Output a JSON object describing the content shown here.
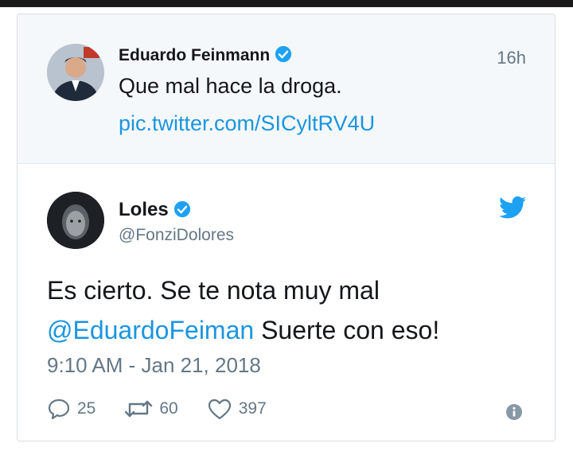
{
  "quoted_tweet": {
    "name": "Eduardo Feinmann",
    "time": "16h",
    "text": "Que mal hace la droga.",
    "link": "pic.twitter.com/SICyltRV4U"
  },
  "main_tweet": {
    "name": "Loles",
    "handle": "@FonziDolores",
    "text_line1": "Es cierto. Se te nota muy mal",
    "mention": "@EduardoFeiman",
    "text_line2_rest": " Suerte con eso!",
    "date": "9:10 AM - Jan 21, 2018",
    "replies": "25",
    "retweets": "60",
    "likes": "397"
  },
  "colors": {
    "accent": "#1b95e0",
    "verified": "#1da1f2",
    "muted": "#657786",
    "quoted_bg": "#f5f8fa"
  },
  "icons": [
    "verified-badge-icon",
    "twitter-bird-icon",
    "reply-icon",
    "retweet-icon",
    "heart-icon",
    "info-icon"
  ]
}
